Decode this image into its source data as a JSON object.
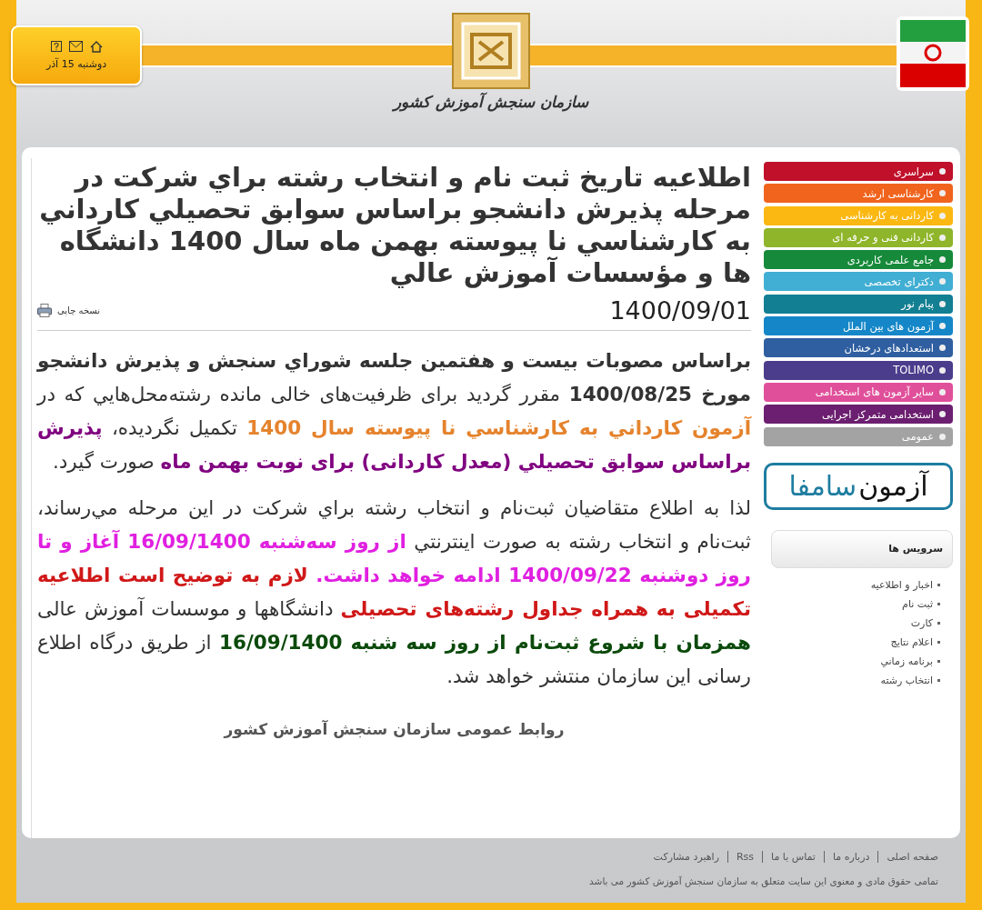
{
  "header": {
    "date": "دوشنبه 15 آذر",
    "logo_text": "سازمان سنجش آموزش کشور"
  },
  "article": {
    "title": "اطلاعیه تاریخ ثبت نام و انتخاب رشته براي شرکت در مرحله پذيرش دانشجو براساس سوابق تحصيلي کارداني به کارشناسي نا پيوسته بهمن ماه سال 1400 دانشگاه ها و مؤسسات آموزش عالي",
    "date": "1400/09/01",
    "print_label": "نسخه چاپی",
    "paragraphs": [
      [
        {
          "text": "براساس مصوبات بیست و هفتمین جلسه شوراي سنجش و پذيرش دانشجو مورخ 1400/08/25",
          "bold": true,
          "color": "#333333"
        },
        {
          "text": " مقرر گردید برای ظرفیت‌های خالی مانده رشته‌محل‌هايي که در ",
          "bold": false,
          "color": "#333333"
        },
        {
          "text": "آزمون کارداني به کارشناسي نا پيوسته سال 1400",
          "bold": true,
          "color": "#e5832d"
        },
        {
          "text": " تکمیل نگرديده، ",
          "bold": false,
          "color": "#333333"
        },
        {
          "text": "پذيرش براساس سوابق تحصيلي (معدل کاردانی) برای نوبت بهمن ماه",
          "bold": true,
          "color": "#800080"
        },
        {
          "text": " صورت گیرد.",
          "bold": false,
          "color": "#333333"
        }
      ],
      [
        {
          "text": "لذا به اطلاع متقاضيان ثبت‌نام و انتخاب رشته براي شرکت در اين مرحله مي‌رساند، ثبت‌نام و انتخاب رشته به صورت اينترنتي ",
          "bold": false,
          "color": "#333333"
        },
        {
          "text": "از روز سه‌شنبه 16/09/1400 آغاز و تا روز دوشنبه 1400/09/22 ادامه خواهد داشت.",
          "bold": true,
          "color": "#e020e0"
        },
        {
          "text": " لازم به توضیح است اطلاعیه تکمیلی به همراه جداول رشته‌های تحصیلی",
          "bold": true,
          "color": "#d01818"
        },
        {
          "text": " دانشگاهها و موسسات آموزش عالی ",
          "bold": false,
          "color": "#333333"
        },
        {
          "text": "همزمان با شروع ثبت‌نام از روز سه شنبه 16/09/1400",
          "bold": true,
          "color": "#0b4a0b"
        },
        {
          "text": " از طريق درگاه اطلاع رسانی اين سازمان منتشر خواهد شد.",
          "bold": false,
          "color": "#333333"
        }
      ]
    ],
    "signature": "روابط عمومی سازمان سنجش آموزش کشور"
  },
  "sidebar": {
    "menu": [
      {
        "label": "سراسری",
        "color": "#c0102a"
      },
      {
        "label": "کارشناسی ارشد",
        "color": "#f0641e"
      },
      {
        "label": "کاردانی به کارشناسی",
        "color": "#fbb812"
      },
      {
        "label": "کاردانی فنی و حرفه ای",
        "color": "#8fb52a"
      },
      {
        "label": "جامع علمی کاربردی",
        "color": "#168a3a"
      },
      {
        "label": "دکترای تخصصی",
        "color": "#41aed3"
      },
      {
        "label": "پیام نور",
        "color": "#127f92"
      },
      {
        "label": "آزمون های بین الملل",
        "color": "#1587c8"
      },
      {
        "label": "استعدادهای درخشان",
        "color": "#2f5fa0"
      },
      {
        "label": "TOLIMO",
        "color": "#4c3d8c"
      },
      {
        "label": "سایر آزمون های استخدامی",
        "color": "#e0509a"
      },
      {
        "label": "استخدامی متمرکز اجرایی",
        "color": "#6c1f70"
      },
      {
        "label": "عمومی",
        "color": "#a3a3a3"
      }
    ],
    "banner": {
      "word_1": "آزمون",
      "word_2": "سامفا"
    },
    "services": {
      "title": "سرويس ها",
      "links": [
        "اخبار و اطلاعیه",
        "ثبت نام",
        "کارت",
        "اعلام نتايج",
        "برنامه زماني",
        "انتخاب رشته"
      ]
    }
  },
  "footer": {
    "links": [
      "صفحه اصلی",
      "درباره ما",
      "تماس با ما",
      "Rss",
      "راهبرد مشارکت"
    ],
    "copyright": "تمامی حقوق مادی و معنوی این سایت متعلق به سازمان سنجش آموزش کشور می باشد"
  }
}
